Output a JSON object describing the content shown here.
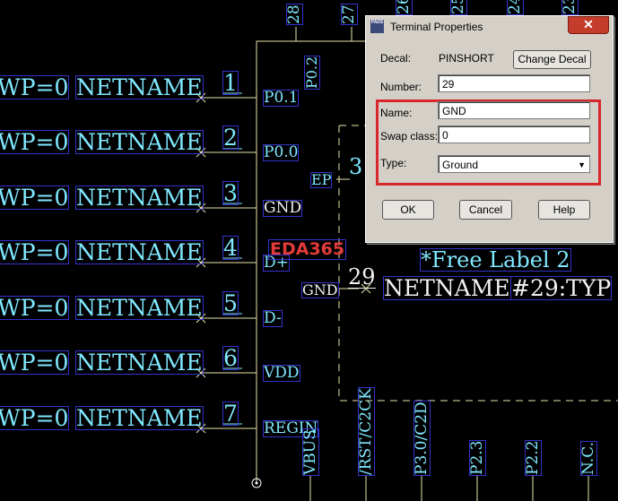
{
  "schematic": {
    "rows": [
      {
        "wp": "WP=0",
        "net": "NETNAME",
        "num": "1",
        "pin": "P0.1"
      },
      {
        "wp": "WP=0",
        "net": "NETNAME",
        "num": "2",
        "pin": "P0.0"
      },
      {
        "wp": "WP=0",
        "net": "NETNAME",
        "num": "3",
        "pin": "GND"
      },
      {
        "wp": "WP=0",
        "net": "NETNAME",
        "num": "4",
        "pin": "D+"
      },
      {
        "wp": "WP=0",
        "net": "NETNAME",
        "num": "5",
        "pin": "D-"
      },
      {
        "wp": "WP=0",
        "net": "NETNAME",
        "num": "6",
        "pin": "VDD"
      },
      {
        "wp": "WP=0",
        "net": "NETNAME",
        "num": "7",
        "pin": "REGIN"
      }
    ],
    "top_pins": [
      "28",
      "27",
      "26",
      "25",
      "24",
      "23"
    ],
    "p02_label": "P0.2",
    "ep_label": "EP",
    "ep_num": "3",
    "logo": "EDA365",
    "free_label": "*Free Label 2",
    "sel_pin_name": "GND",
    "sel_pin_num": "29",
    "sel_net": "NETNAME",
    "sel_type": "#29:TYP",
    "bottom_labels": [
      "VBUS",
      "/RST/C2CK",
      "P3.0/C2D",
      "P2.3",
      "P2.2",
      "N.C."
    ]
  },
  "dialog": {
    "title": "Terminal Properties",
    "app_icon": "PADS",
    "close_label": "✕",
    "decal_label": "Decal:",
    "decal_value": "PINSHORT",
    "change_decal": "Change Decal",
    "number_label": "Number:",
    "number_value": "29",
    "name_label": "Name:",
    "name_value": "GND",
    "swap_label": "Swap class:",
    "swap_value": "0",
    "type_label": "Type:",
    "type_value": "Ground",
    "ok": "OK",
    "cancel": "Cancel",
    "help": "Help",
    "highlight_color": "#d8262c"
  },
  "colors": {
    "background": "#000000",
    "pin_text": "#7fe8ff",
    "outline": "#3333cc",
    "body_line": "#e8e4a8"
  }
}
